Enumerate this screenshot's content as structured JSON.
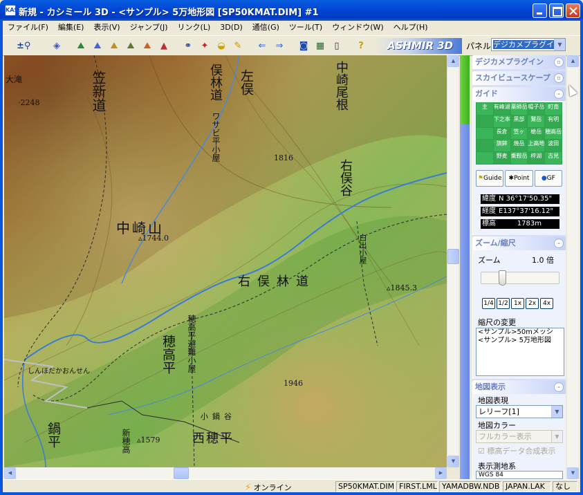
{
  "window": {
    "title": "新規 - カシミール 3D - <サンプル> 5万地形図 [SP50KMAT.DIM] #1",
    "icon_label": "KAS"
  },
  "menu": [
    "ファイル(F)",
    "編集(E)",
    "表示(V)",
    "ジャンプ(J)",
    "リンク(L)",
    "3D(D)",
    "通信(G)",
    "ツール(T)",
    "ウィンドウ(W)",
    "ヘルプ(H)"
  ],
  "toolbar": {
    "icons": [
      "zoom-search-icon",
      "layer-icon",
      "map-icon-1",
      "map-icon-2",
      "map-icon-3",
      "map-icon-4",
      "map-icon-5",
      "binoculars-icon",
      "marker-icon",
      "gps-icon",
      "pencil-icon",
      "back-arrow-icon",
      "forward-arrow-icon",
      "camera-icon",
      "film-icon",
      "device-icon",
      "help-icon",
      "kashmir-icon"
    ],
    "brand": "ASHMIR 3D",
    "panel_label": "パネル",
    "panel_select": "デジカメプラグイ"
  },
  "map": {
    "labels": {
      "kasashinmichi": "笠新道",
      "komata": "左俣",
      "komata2": "俣林道",
      "wasabi": "ワサビ平小屋",
      "nakazaki_one": "中崎尾根",
      "migimata": "右俣谷",
      "nakazakiyama": "中崎山",
      "elev1744": "▵1744.0",
      "elev1816": "1816",
      "migimata_rindo": "右俣林道",
      "hakusan": "白出小屋",
      "elev1845": "▵1845.3",
      "hotaka_hinan": "穂高平避難小屋",
      "hotakadaira": "穂高平",
      "onsen": "しんほだかおんせん",
      "elev1946": "1946",
      "nishihotaka": "西穂平",
      "elev1579": "▵1579",
      "nabedaira": "鍋平",
      "elev2248": "·2248",
      "otaki": "大滝",
      "kobase": "小鍋谷",
      "shinhotaka": "新穂高"
    }
  },
  "right_panel": {
    "sections": {
      "digicam": "デジカメプラグイン",
      "skyview": "スカイビュースケープ",
      "guide": "ガイド",
      "zoom": "ズーム/縮尺",
      "mapdisplay": "地図表示"
    },
    "guide_grid": [
      "主",
      "有峰湖",
      "薬師岳",
      "帽子岳",
      "町南",
      "",
      "下之本",
      "黒部",
      "鷲岳",
      "有明",
      "",
      "長倉",
      "笠ヶ",
      "槍岳",
      "穂高岳",
      "",
      "旗鉾",
      "焼岳",
      "上高地",
      "波田",
      "",
      "野麦",
      "乗鞍岳",
      "梓湖",
      "古見"
    ],
    "guide_tabs": [
      "Guide",
      "Point",
      "GF"
    ],
    "coords": {
      "lat_label": "緯度",
      "lat": "N 36°17'50.35\"",
      "lon_label": "経度",
      "lon": "E137°37'16.12\"",
      "elev_label": "標高",
      "elev": "1783m"
    },
    "zoom": {
      "label": "ズーム",
      "value": "1.0 倍",
      "level_fraction": 0.25,
      "buttons": [
        "1/4",
        "1/2",
        "1x",
        "2x",
        "4x"
      ]
    },
    "scale": {
      "label": "縮尺の変更",
      "items": [
        "<サンプル>50mメッシ",
        "<サンプル> 5万地形図"
      ]
    },
    "mapdisplay": {
      "expression_label": "地図表現",
      "expression_value": "レリーフ[1]",
      "color_label": "地図カラー",
      "color_value": "フルカラー表示",
      "elev_data_check": "標高データ合成表示",
      "datum_label": "表示測地系",
      "datum_value": "WGS 84"
    }
  },
  "status": {
    "online": "オンライン",
    "cells": [
      "SP50KMAT.DIM",
      "FIRST.LML",
      "YAMADBW.NDB",
      "JAPAN.LAK",
      "なし"
    ]
  }
}
